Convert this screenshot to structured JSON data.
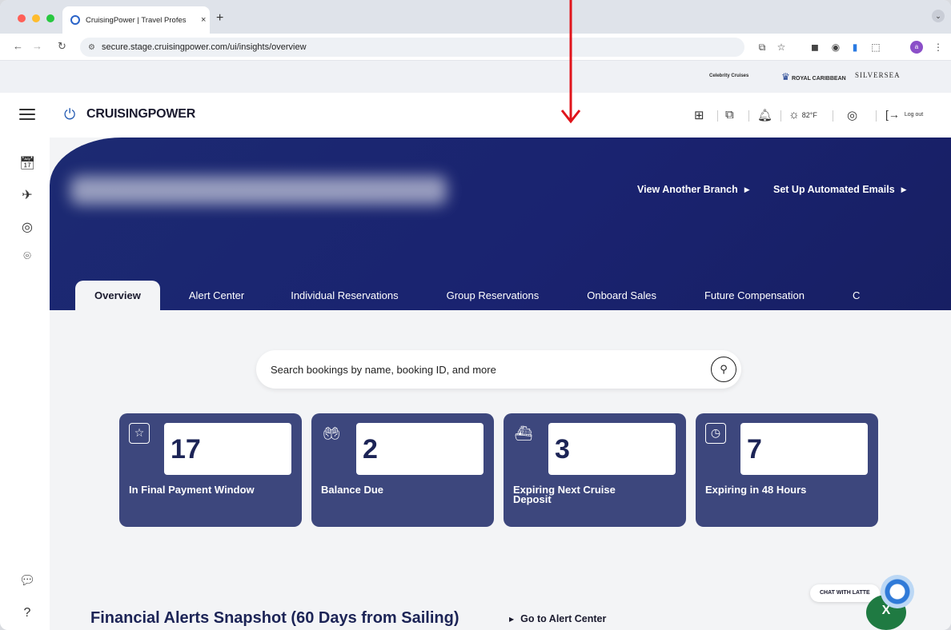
{
  "browser": {
    "tab_title": "CruisingPower | Travel Profes",
    "tab_close": "×",
    "new_tab": "+",
    "url_prefix": "secure.stage.cruisingpower.com",
    "url": "secure.stage.cruisingpower.com/ui/insights/overview",
    "profile_initial": "a"
  },
  "brands": [
    "Celebrity Cruises",
    "ROYAL CARIBBEAN",
    "SILVERSEA"
  ],
  "header": {
    "logo": "CRUISINGPOWER",
    "temperature": "82°F",
    "logout": "Log out"
  },
  "banner": {
    "links": [
      "View Another Branch",
      "Set Up Automated Emails"
    ]
  },
  "tabs": [
    "Overview",
    "Alert Center",
    "Individual Reservations",
    "Group Reservations",
    "Onboard Sales",
    "Future Compensation",
    "C"
  ],
  "search": {
    "placeholder": "Search bookings by name, booking ID, and more"
  },
  "cards": [
    {
      "value": "17",
      "label": "In Final Payment Window",
      "icon": "calendar-star-icon"
    },
    {
      "value": "2",
      "label": "Balance Due",
      "icon": "hand-coins-icon"
    },
    {
      "value": "3",
      "label": "Expiring Next Cruise Deposit",
      "icon": "ship-icon"
    },
    {
      "value": "7",
      "label": "Expiring in 48 Hours",
      "icon": "clock-icon"
    }
  ],
  "chat": {
    "label": "CHAT WITH LATTE"
  },
  "excel": {
    "label": "X"
  },
  "snapshot": {
    "title": "Financial Alerts Snapshot (60 Days from Sailing)",
    "link": "Go to Alert Center"
  },
  "colors": {
    "banner": "#1a2370",
    "card": "#3d477d",
    "value": "#1c2456",
    "annotation_arrow": "#e0141b"
  }
}
